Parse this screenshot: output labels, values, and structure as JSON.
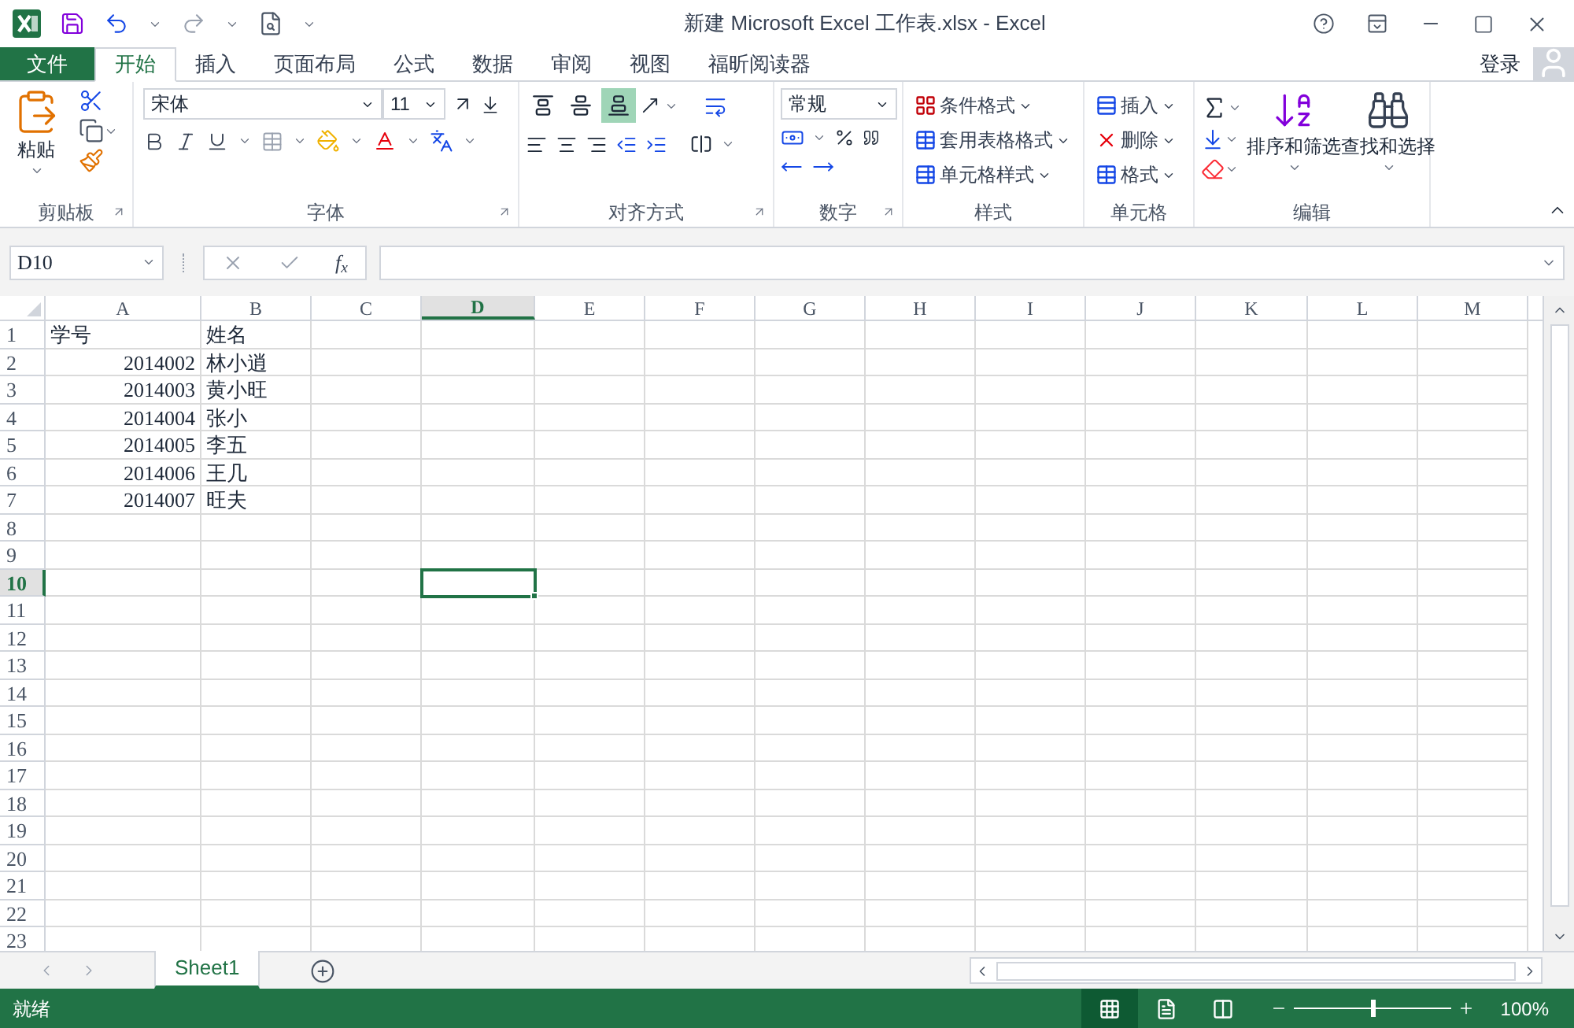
{
  "window": {
    "title": "新建 Microsoft Excel 工作表.xlsx - Excel"
  },
  "tabs": [
    {
      "label": "文件",
      "kind": "file",
      "selected": false
    },
    {
      "label": "开始",
      "kind": "tab",
      "selected": true
    },
    {
      "label": "插入",
      "kind": "tab",
      "selected": false
    },
    {
      "label": "页面布局",
      "kind": "tab",
      "selected": false
    },
    {
      "label": "公式",
      "kind": "tab",
      "selected": false
    },
    {
      "label": "数据",
      "kind": "tab",
      "selected": false
    },
    {
      "label": "审阅",
      "kind": "tab",
      "selected": false
    },
    {
      "label": "视图",
      "kind": "tab",
      "selected": false
    },
    {
      "label": "福昕阅读器",
      "kind": "tab",
      "selected": false
    }
  ],
  "account": {
    "label": "登录"
  },
  "ribbon": {
    "clipboard": {
      "label": "剪贴板",
      "paste": "粘贴"
    },
    "font": {
      "label": "字体",
      "font_name": "宋体",
      "font_size": "11"
    },
    "alignment": {
      "label": "对齐方式",
      "vertical": [
        {
          "kind": "top",
          "selected": false
        },
        {
          "kind": "middle",
          "selected": false
        },
        {
          "kind": "bottom",
          "selected": true
        }
      ]
    },
    "number": {
      "label": "数字",
      "format": "常规"
    },
    "styles": {
      "label": "样式",
      "items": [
        "条件格式",
        "套用表格格式",
        "单元格样式"
      ]
    },
    "cells": {
      "label": "单元格",
      "items": [
        "插入",
        "删除",
        "格式"
      ]
    },
    "editing": {
      "label": "编辑",
      "items": [
        "排序和筛选",
        "查找和选择"
      ]
    }
  },
  "formula_bar": {
    "name_box": "D10",
    "function_label": "f$_{x}$"
  },
  "sheet": {
    "columns": [
      {
        "label": "A",
        "selected": false
      },
      {
        "label": "B",
        "selected": false
      },
      {
        "label": "C",
        "selected": false
      },
      {
        "label": "D",
        "selected": true
      },
      {
        "label": "E",
        "selected": false
      },
      {
        "label": "F",
        "selected": false
      },
      {
        "label": "G",
        "selected": false
      },
      {
        "label": "H",
        "selected": false
      },
      {
        "label": "I",
        "selected": false
      },
      {
        "label": "J",
        "selected": false
      },
      {
        "label": "K",
        "selected": false
      },
      {
        "label": "L",
        "selected": false
      },
      {
        "label": "M",
        "selected": false
      }
    ],
    "rows": [
      {
        "label": "1",
        "selected": false,
        "cells": [
          {
            "value": "学号",
            "kind": "text"
          },
          {
            "value": "姓名",
            "kind": "text"
          }
        ]
      },
      {
        "label": "2",
        "selected": false,
        "cells": [
          {
            "value": "2014002",
            "kind": "number"
          },
          {
            "value": "林小逍",
            "kind": "text"
          }
        ]
      },
      {
        "label": "3",
        "selected": false,
        "cells": [
          {
            "value": "2014003",
            "kind": "number"
          },
          {
            "value": "黄小旺",
            "kind": "text"
          }
        ]
      },
      {
        "label": "4",
        "selected": false,
        "cells": [
          {
            "value": "2014004",
            "kind": "number"
          },
          {
            "value": "张小",
            "kind": "text"
          }
        ]
      },
      {
        "label": "5",
        "selected": false,
        "cells": [
          {
            "value": "2014005",
            "kind": "number"
          },
          {
            "value": "李五",
            "kind": "text"
          }
        ]
      },
      {
        "label": "6",
        "selected": false,
        "cells": [
          {
            "value": "2014006",
            "kind": "number"
          },
          {
            "value": "王几",
            "kind": "text"
          }
        ]
      },
      {
        "label": "7",
        "selected": false,
        "cells": [
          {
            "value": "2014007",
            "kind": "number"
          },
          {
            "value": "旺夫",
            "kind": "text"
          }
        ]
      },
      {
        "label": "8",
        "selected": false,
        "cells": []
      },
      {
        "label": "9",
        "selected": false,
        "cells": []
      },
      {
        "label": "10",
        "selected": true,
        "cells": []
      },
      {
        "label": "11",
        "selected": false,
        "cells": []
      },
      {
        "label": "12",
        "selected": false,
        "cells": []
      },
      {
        "label": "13",
        "selected": false,
        "cells": []
      },
      {
        "label": "14",
        "selected": false,
        "cells": []
      },
      {
        "label": "15",
        "selected": false,
        "cells": []
      },
      {
        "label": "16",
        "selected": false,
        "cells": []
      },
      {
        "label": "17",
        "selected": false,
        "cells": []
      },
      {
        "label": "18",
        "selected": false,
        "cells": []
      },
      {
        "label": "19",
        "selected": false,
        "cells": []
      },
      {
        "label": "20",
        "selected": false,
        "cells": []
      },
      {
        "label": "21",
        "selected": false,
        "cells": []
      },
      {
        "label": "22",
        "selected": false,
        "cells": []
      },
      {
        "label": "23",
        "selected": false,
        "cells": []
      }
    ]
  },
  "sheet_tabs": [
    {
      "label": "Sheet1",
      "selected": true
    }
  ],
  "status_bar": {
    "status": "就绪",
    "views": [
      {
        "kind": "normal",
        "selected": true
      },
      {
        "kind": "page_layout",
        "selected": false
      },
      {
        "kind": "page_break",
        "selected": false
      }
    ],
    "zoom": {
      "level": 0.5
    },
    "zoom_text": "100%"
  }
}
